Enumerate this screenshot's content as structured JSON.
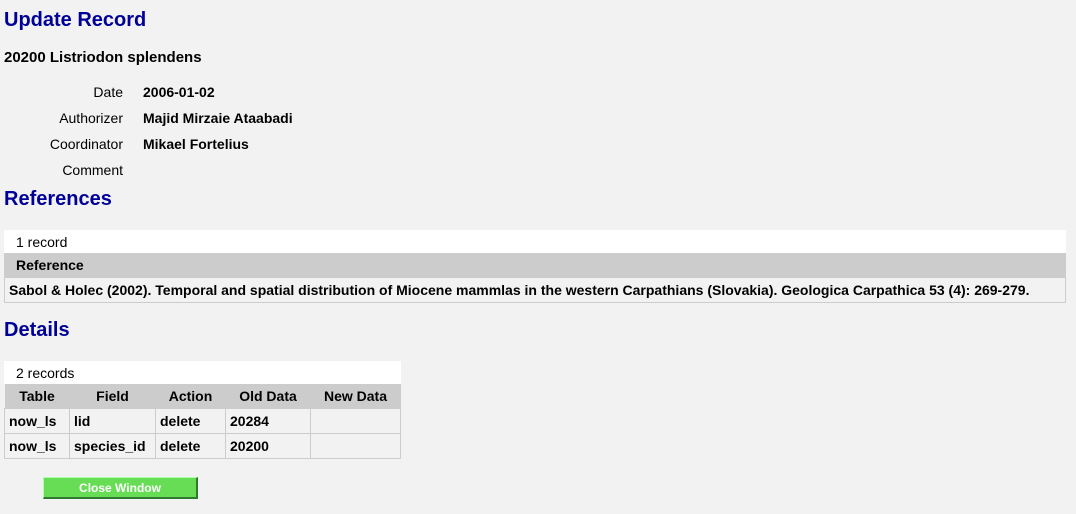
{
  "update_record": {
    "heading": "Update Record",
    "record_title": "20200 Listriodon splendens",
    "fields": [
      {
        "label": "Date",
        "value": "2006-01-02"
      },
      {
        "label": "Authorizer",
        "value": "Majid Mirzaie Ataabadi"
      },
      {
        "label": "Coordinator",
        "value": "Mikael Fortelius"
      },
      {
        "label": "Comment",
        "value": ""
      }
    ]
  },
  "references": {
    "heading": "References",
    "count": "1 record",
    "column": "Reference",
    "rows": [
      "Sabol & Holec (2002). Temporal and spatial distribution of Miocene mammlas in the western Carpathians (Slovakia). Geologica Carpathica 53 (4): 269-279."
    ]
  },
  "details": {
    "heading": "Details",
    "count": "2 records",
    "columns": [
      "Table",
      "Field",
      "Action",
      "Old Data",
      "New Data"
    ],
    "rows": [
      [
        "now_ls",
        "lid",
        "delete",
        "20284",
        ""
      ],
      [
        "now_ls",
        "species_id",
        "delete",
        "20200",
        ""
      ]
    ]
  },
  "close_button": "Close Window",
  "colors": {
    "heading": "#000099",
    "background": "#f2f2f2",
    "button": "#66dd55",
    "table_header": "#cccccc"
  }
}
